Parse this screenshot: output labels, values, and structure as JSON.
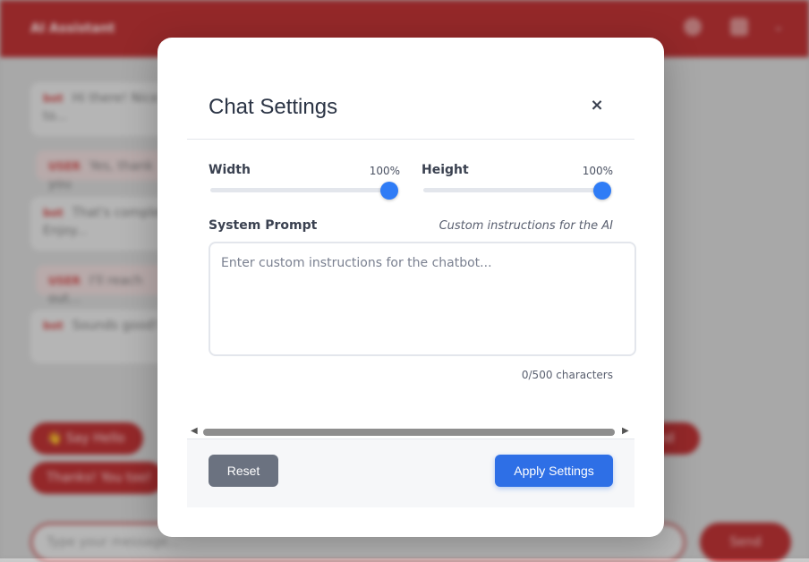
{
  "app": {
    "title": "AI Assistant",
    "messages": [
      {
        "role": "bot",
        "who": "bot",
        "text": "Hi there! Nice to meet you. Would you like to..."
      },
      {
        "role": "user",
        "who": "USER",
        "text": "Yes, thank you"
      },
      {
        "role": "bot",
        "who": "bot",
        "text": "That's completely fine! Feel free to ask. Enjoy..."
      },
      {
        "role": "user",
        "who": "USER",
        "text": "I'll reach out..."
      },
      {
        "role": "bot",
        "who": "bot",
        "text": "Sounds good! I'm always here to help!"
      }
    ],
    "quick_replies": [
      "👋 Say Hello",
      "Thanks! You too!",
      "Send"
    ],
    "input_placeholder": "Type your message...",
    "send_label": "Send"
  },
  "modal": {
    "title": "Chat Settings",
    "close_glyph": "×",
    "width": {
      "label": "Width",
      "value_text": "100%",
      "value": 1.0
    },
    "height": {
      "label": "Height",
      "value_text": "100%",
      "value": 1.0
    },
    "system_prompt": {
      "label": "System Prompt",
      "hint": "Custom instructions for the AI",
      "value": "",
      "placeholder": "Enter custom instructions for the chatbot...",
      "char_count": "0/500 characters"
    },
    "scroll_left": "◀",
    "scroll_right": "▶",
    "reset_label": "Reset",
    "apply_label": "Apply Settings"
  },
  "colors": {
    "brand": "#b8282a",
    "accent": "#2f7cf6",
    "reset_bg": "#6b7280"
  }
}
